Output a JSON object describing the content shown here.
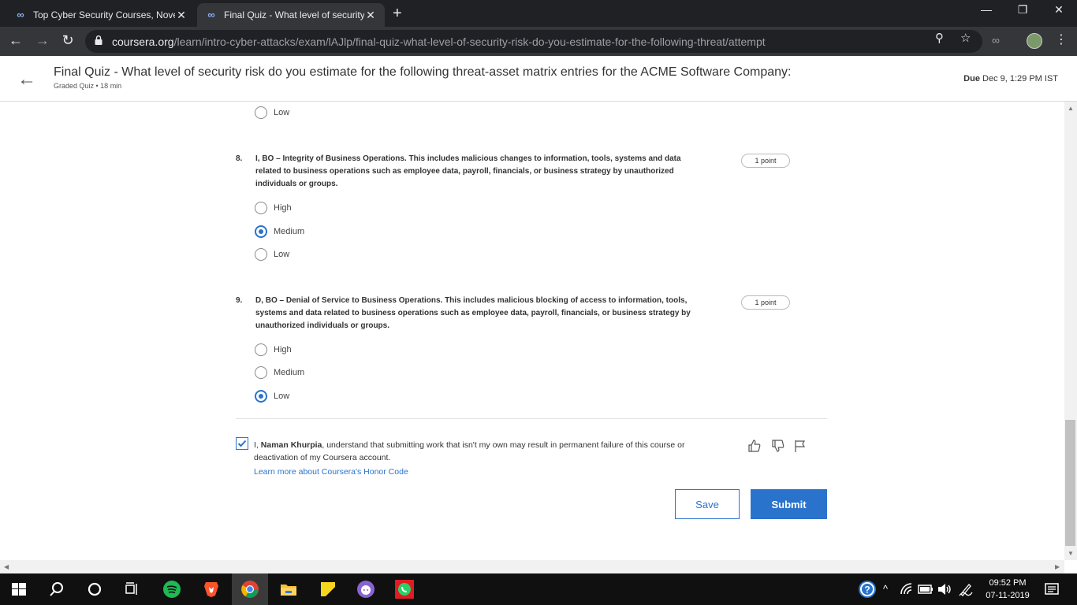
{
  "browser": {
    "tabs": [
      {
        "title": "Top Cyber Security Courses, Nove",
        "active": false
      },
      {
        "title": "Final Quiz - What level of security",
        "active": true
      }
    ],
    "new_tab": "+",
    "url_host": "coursera.org",
    "url_path": "/learn/intro-cyber-attacks/exam/lAJlp/final-quiz-what-level-of-security-risk-do-you-estimate-for-the-following-threat/attempt"
  },
  "header": {
    "title": "Final Quiz - What level of security risk do you estimate for the following threat-asset matrix entries for the ACME Software Company:",
    "subtitle": "Graded Quiz • 18 min",
    "due_label": "Due",
    "due_date": "Dec 9, 1:29 PM IST"
  },
  "prev_question": {
    "options": [
      {
        "label": "Low",
        "selected": false
      }
    ]
  },
  "questions": [
    {
      "number": "8.",
      "text": "I, BO – Integrity of Business Operations. This includes malicious changes to information, tools, systems and data related to business operations such as employee data, payroll, financials, or business strategy by unauthorized individuals or groups.",
      "points": "1 point",
      "options": [
        {
          "label": "High",
          "selected": false
        },
        {
          "label": "Medium",
          "selected": true
        },
        {
          "label": "Low",
          "selected": false
        }
      ]
    },
    {
      "number": "9.",
      "text": "D, BO – Denial of Service to Business Operations. This includes malicious blocking of access to information, tools, systems and data related to business operations such as employee data, payroll, financials, or business strategy by unauthorized individuals or groups.",
      "points": "1 point",
      "options": [
        {
          "label": "High",
          "selected": false
        },
        {
          "label": "Medium",
          "selected": false
        },
        {
          "label": "Low",
          "selected": true
        }
      ]
    }
  ],
  "honor": {
    "checked": true,
    "prefix": "I,",
    "name": "Naman Khurpia",
    "suffix": ", understand that submitting work that isn't my own may result in permanent failure of this course or deactivation of my Coursera account.",
    "link": "Learn more about Coursera's Honor Code"
  },
  "actions": {
    "save_label": "Save",
    "submit_label": "Submit"
  },
  "taskbar": {
    "time": "09:52 PM",
    "date": "07-11-2019"
  },
  "colors": {
    "accent": "#2a73cc",
    "chrome_dark": "#202124",
    "chrome_mid": "#35363a",
    "taskbar": "#101010"
  }
}
